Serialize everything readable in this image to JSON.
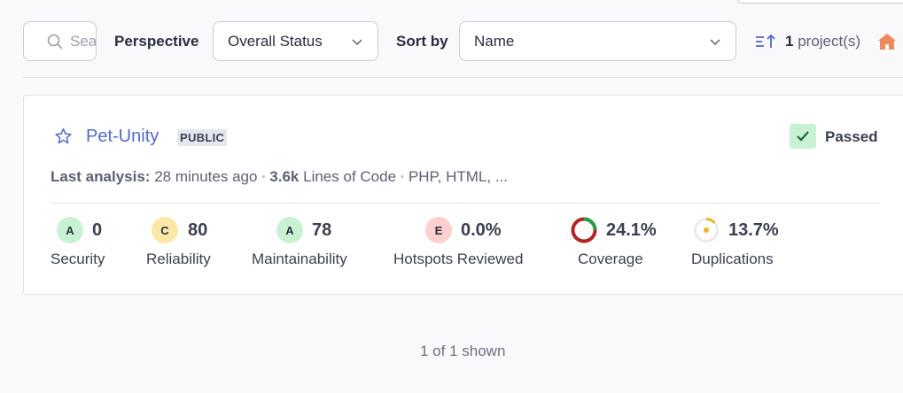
{
  "toolbar": {
    "search_placeholder": "Search",
    "perspective_label": "Perspective",
    "perspective_value": "Overall Status",
    "sort_label": "Sort by",
    "sort_value": "Name",
    "project_count": "1",
    "project_count_suffix": "project(s)"
  },
  "project": {
    "name": "Pet-Unity",
    "visibility": "PUBLIC",
    "status": "Passed",
    "last_analysis_label": "Last analysis:",
    "last_analysis_value": "28 minutes ago",
    "lines_value": "3.6k",
    "lines_label": "Lines of Code",
    "languages": "PHP, HTML, ..."
  },
  "metrics": [
    {
      "grade": "A",
      "value": "0",
      "label": "Security"
    },
    {
      "grade": "C",
      "value": "80",
      "label": "Reliability"
    },
    {
      "grade": "A",
      "value": "78",
      "label": "Maintainability"
    },
    {
      "grade": "E",
      "value": "0.0%",
      "label": "Hotspots Reviewed"
    },
    {
      "value": "24.1%",
      "label": "Coverage",
      "fraction": 0.241
    },
    {
      "value": "13.7%",
      "label": "Duplications",
      "fraction": 0.137
    }
  ],
  "colors": {
    "grade_a_bg": "#c9f2d3",
    "grade_c_bg": "#fce8a6",
    "grade_e_bg": "#fdcfcf",
    "coverage_good": "#24a148",
    "coverage_bad": "#b32424",
    "duplication_accent": "#f0b429",
    "link": "#5469c9",
    "home_icon": "#ee8a5c"
  },
  "footer": {
    "shown": "1 of 1 shown"
  }
}
